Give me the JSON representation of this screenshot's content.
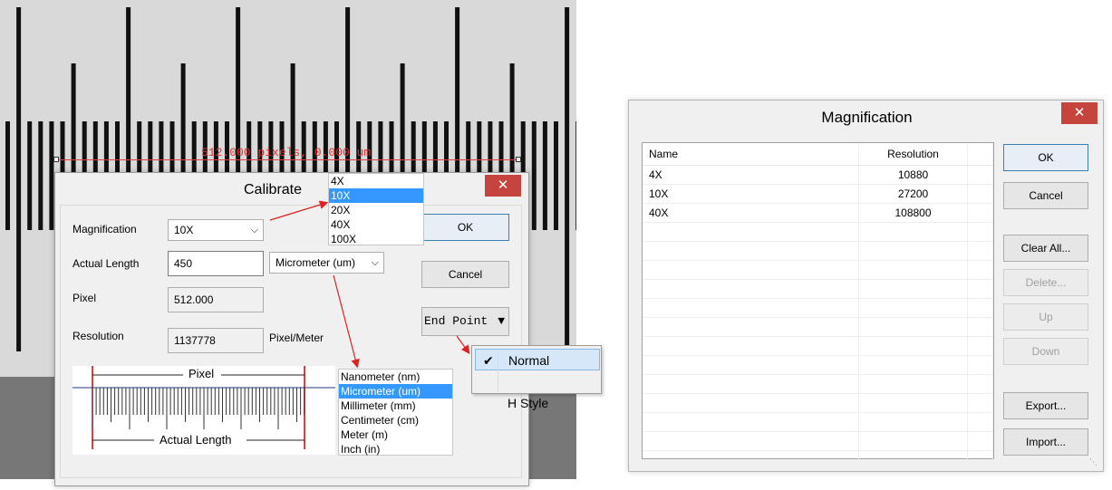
{
  "ruler": {
    "measurement_label": "512.000 pixels, 0.000 um"
  },
  "calibrate": {
    "title": "Calibrate",
    "close_symbol": "✕",
    "magnification_label": "Magnification",
    "magnification_value": "10X",
    "actual_length_label": "Actual Length",
    "actual_length_value": "450",
    "unit_value": "Micrometer (um)",
    "pixel_label": "Pixel",
    "pixel_value": "512.000",
    "resolution_label": "Resolution",
    "resolution_value": "1137778",
    "resolution_unit": "Pixel/Meter",
    "ok_label": "OK",
    "cancel_label": "Cancel",
    "endpoint_label": "End Point",
    "diagram_pixel_label": "Pixel",
    "diagram_actual_label": "Actual Length",
    "accent_close": "#c6443e",
    "selection_color": "#3399ff"
  },
  "magnification_dropdown": {
    "options": [
      "4X",
      "10X",
      "20X",
      "40X",
      "100X"
    ],
    "selected": "10X"
  },
  "unit_dropdown": {
    "options": [
      "Nanometer (nm)",
      "Micrometer (um)",
      "Millimeter (mm)",
      "Centimeter (cm)",
      "Meter (m)",
      "Inch (in)"
    ],
    "selected": "Micrometer (um)"
  },
  "endpoint_menu": {
    "items": [
      {
        "label": "Normal",
        "checked": true
      },
      {
        "label": "H Style",
        "checked": false
      }
    ]
  },
  "magnification_dialog": {
    "title": "Magnification",
    "close_symbol": "✕",
    "columns": [
      "Name",
      "Resolution"
    ],
    "rows": [
      {
        "name": "4X",
        "resolution": "10880"
      },
      {
        "name": "10X",
        "resolution": "27200"
      },
      {
        "name": "40X",
        "resolution": "108800"
      }
    ],
    "buttons": {
      "ok": "OK",
      "cancel": "Cancel",
      "clear_all": "Clear All...",
      "delete": "Delete...",
      "up": "Up",
      "down": "Down",
      "export": "Export...",
      "import": "Import..."
    }
  }
}
